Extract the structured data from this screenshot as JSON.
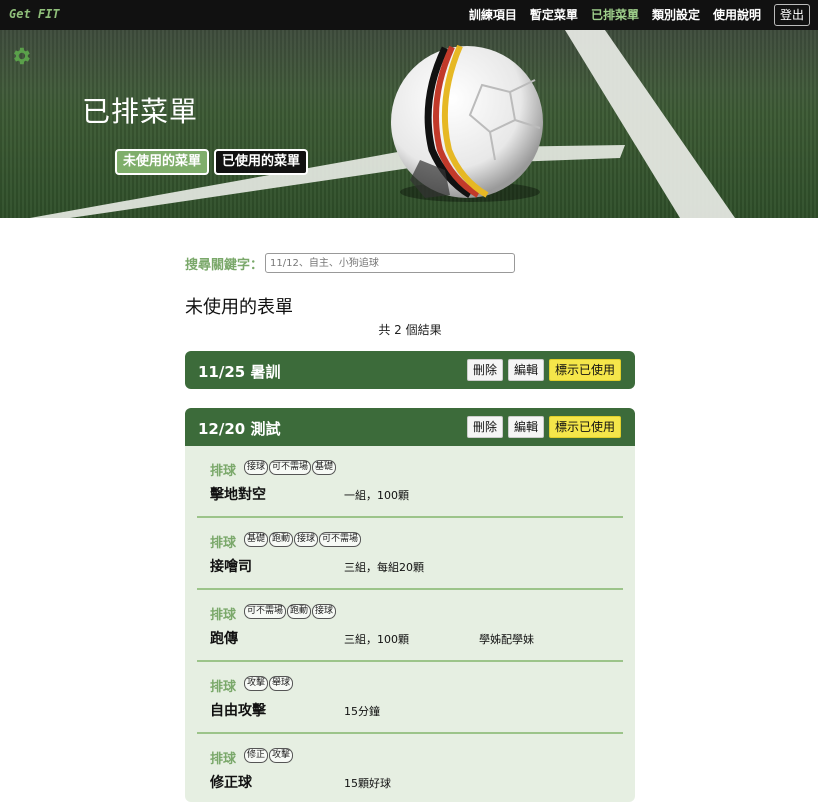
{
  "navbar": {
    "brand": "Get FIT",
    "items": [
      {
        "label": "訓練項目",
        "active": false
      },
      {
        "label": "暫定菜單",
        "active": false
      },
      {
        "label": "已排菜單",
        "active": true
      },
      {
        "label": "類別設定",
        "active": false
      },
      {
        "label": "使用說明",
        "active": false
      }
    ],
    "logout": "登出"
  },
  "hero": {
    "title": "已排菜單",
    "tab_unused": "未使用的菜單",
    "tab_used": "已使用的菜單",
    "settings_icon": "gear-icon"
  },
  "search": {
    "label": "搜尋關鍵字：",
    "placeholder": "11/12、自主、小狗追球",
    "value": ""
  },
  "section": {
    "title": "未使用的表單",
    "result_count": "共 2 個結果"
  },
  "colors": {
    "card_header": "#3c6b3a",
    "card_body": "#e6efe2",
    "accent_green": "#7aa86a",
    "nav_active": "#9fd08c",
    "mark_used_button": "#f5e64a"
  },
  "menus": [
    {
      "title": "11/25 暑訓",
      "delete": "刪除",
      "edit": "編輯",
      "mark_used": "標示已使用",
      "expanded": false,
      "items": []
    },
    {
      "title": "12/20 測試",
      "delete": "刪除",
      "edit": "編輯",
      "mark_used": "標示已使用",
      "expanded": true,
      "items": [
        {
          "sport": "排球",
          "tags": [
            "接球",
            "可不需場",
            "基礎"
          ],
          "name": "擊地對空",
          "amount": "一組，100顆",
          "note": ""
        },
        {
          "sport": "排球",
          "tags": [
            "基礎",
            "跑動",
            "接球",
            "可不需場"
          ],
          "name": "接噲司",
          "amount": "三組，每組20顆",
          "note": ""
        },
        {
          "sport": "排球",
          "tags": [
            "可不需場",
            "跑動",
            "接球"
          ],
          "name": "跑傳",
          "amount": "三組，100顆",
          "note": "學姊配學妹"
        },
        {
          "sport": "排球",
          "tags": [
            "攻擊",
            "舉球"
          ],
          "name": "自由攻擊",
          "amount": "15分鐘",
          "note": ""
        },
        {
          "sport": "排球",
          "tags": [
            "修正",
            "攻擊"
          ],
          "name": "修正球",
          "amount": "15顆好球",
          "note": ""
        }
      ]
    }
  ]
}
